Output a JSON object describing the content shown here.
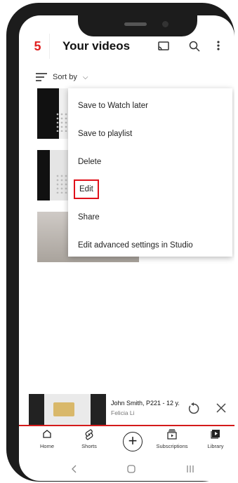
{
  "step_badge": "5",
  "header": {
    "title": "Your videos",
    "icons": [
      "cast-icon",
      "search-icon",
      "more-vert-icon"
    ]
  },
  "sort": {
    "label": "Sort by"
  },
  "menu": {
    "items": [
      {
        "label": "Save to Watch later"
      },
      {
        "label": "Save to playlist"
      },
      {
        "label": "Delete"
      },
      {
        "label": "Edit",
        "highlighted": true
      },
      {
        "label": "Share"
      },
      {
        "label": "Edit advanced settings in Studio"
      }
    ]
  },
  "mini_player": {
    "title": "John Smith, P221 - 12 y.",
    "subtitle": "Felicia Li"
  },
  "bottom_nav": {
    "items": [
      {
        "label": "Home",
        "icon": "home-icon"
      },
      {
        "label": "Shorts",
        "icon": "shorts-icon"
      },
      {
        "label": "",
        "icon": "create-icon"
      },
      {
        "label": "Subscriptions",
        "icon": "subscriptions-icon"
      },
      {
        "label": "Library",
        "icon": "library-icon"
      }
    ]
  },
  "colors": {
    "accent": "#e0101a",
    "nav_line": "#d41b1b"
  }
}
